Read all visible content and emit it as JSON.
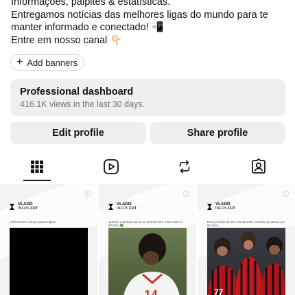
{
  "profile": {
    "bio_lines": [
      "Informações, palpites & estatísticas.",
      "Entregamos notícias das melhores ligas do mundo para te",
      "manter informado e conectado! 📲",
      "Entre em nosso canal 👇🏻"
    ],
    "add_banners_label": "Add banners"
  },
  "dashboard": {
    "title": "Professional dashboard",
    "subtitle": "416.1K views in the last 30 days."
  },
  "actions": {
    "edit_label": "Edit profile",
    "share_label": "Share profile"
  },
  "tabs": [
    {
      "icon": "grid-icon",
      "active": true
    },
    {
      "icon": "reels-icon",
      "active": false
    },
    {
      "icon": "reposts-icon",
      "active": false
    },
    {
      "icon": "tagged-icon",
      "active": false
    }
  ],
  "posts": [
    {
      "brand_line1": "VLADD",
      "brand_line2_a": "INFOS",
      "brand_line2_b": "FUT",
      "caption": "Infelizmente o tempo passa rápido.",
      "icon": "reel-play-icon"
    },
    {
      "brand_line1": "VLADD",
      "brand_line2_a": "INFOS",
      "brand_line2_b": "FUT",
      "caption": "Quando a parada começ na partida entre: HOLANDA X BRASIL 🇧🇷",
      "icon": "reel-play-icon"
    },
    {
      "brand_line1": "VLADD",
      "brand_line2_a": "INFOS",
      "brand_line2_b": "FUT",
      "caption": "Essa seleção do time era absurda. Ancelotti já passou por 92 anos.",
      "icon": "reel-play-icon"
    }
  ],
  "colors": {
    "button_bg": "#efefef",
    "text_primary": "#111111",
    "text_secondary": "#737373"
  }
}
